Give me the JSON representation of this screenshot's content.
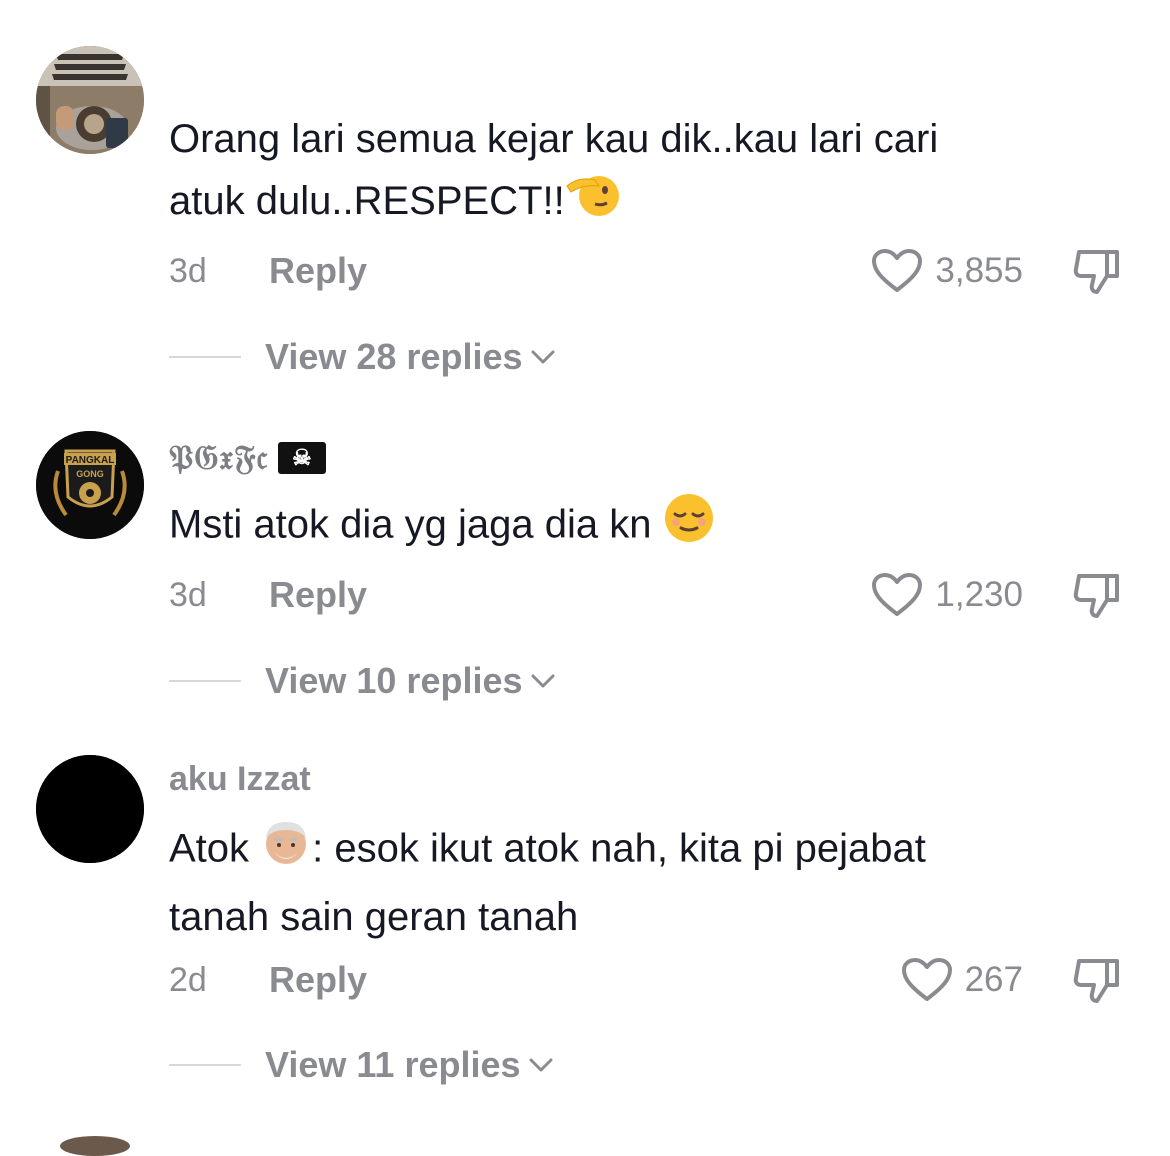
{
  "comments": [
    {
      "username": "",
      "text_line1": "Orang lari semua kejar kau dik..kau lari cari",
      "text_line2": "atuk dulu..RESPECT!!",
      "time": "3d",
      "reply_label": "Reply",
      "likes": "3,855",
      "view_replies": "View 28 replies",
      "avatar_icon": "photo-avatar-icon"
    },
    {
      "username": "𝔓𝔊𝔵𝔉𝔠",
      "text_line1": "Msti atok dia yg jaga dia kn",
      "time": "3d",
      "reply_label": "Reply",
      "likes": "1,230",
      "view_replies": "View 10 replies",
      "avatar_badge_top": "PANGKAL",
      "avatar_badge_bottom": "GONG",
      "avatar_icon": "football-club-badge-icon"
    },
    {
      "username": "aku Izzat",
      "text_prefix": "Atok",
      "text_suffix": ": esok ikut atok nah, kita pi pejabat",
      "text_line2": "tanah sain geran tanah",
      "time": "2d",
      "reply_label": "Reply",
      "likes": "267",
      "view_replies": "View 11 replies",
      "avatar_icon": "black-circle-avatar-icon"
    }
  ],
  "colors": {
    "primary_text": "#161823",
    "secondary_text": "#8a8b91",
    "divider": "#d6d7da"
  }
}
